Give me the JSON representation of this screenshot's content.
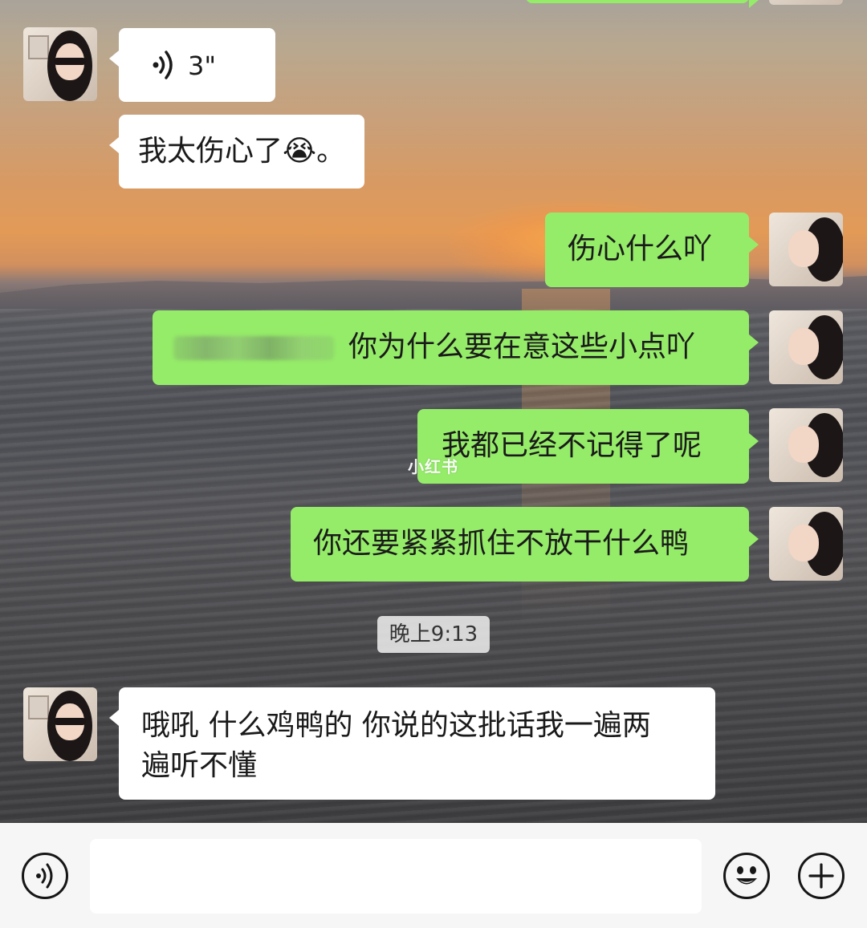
{
  "messages": [
    {
      "side": "left",
      "type": "voice",
      "duration": "3\""
    },
    {
      "side": "left",
      "type": "text",
      "text": "我太伤心了😭。"
    },
    {
      "side": "right",
      "type": "text",
      "text": "伤心什么吖"
    },
    {
      "side": "right",
      "type": "text",
      "text": "你为什么要在意这些小点吖"
    },
    {
      "side": "right",
      "type": "text",
      "text": "我都已经不记得了呢"
    },
    {
      "side": "right",
      "type": "text",
      "text": "你还要紧紧抓住不放干什么鸭"
    },
    {
      "side": "left",
      "type": "text",
      "line1": "哦吼 什么鸡鸭的 你说的这批话我一遍两",
      "line2": "遍听不懂"
    }
  ],
  "timestamp": "晚上9:13",
  "watermark": "小红书",
  "input_bar": {
    "voice_icon": "voice-icon",
    "emoji_icon": "emoji-icon",
    "plus_icon": "plus-icon",
    "input_value": ""
  },
  "colors": {
    "sent_bubble": "#95ec69",
    "received_bubble": "#ffffff",
    "input_bar_bg": "#f6f6f6"
  }
}
